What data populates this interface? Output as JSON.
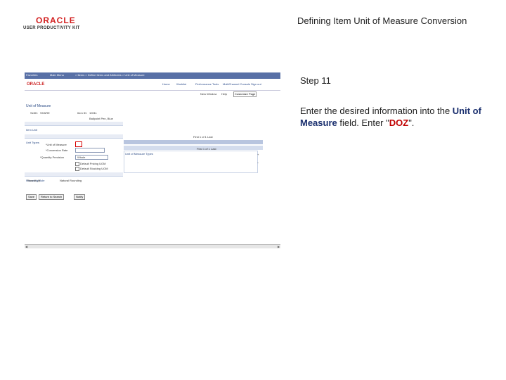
{
  "logo": {
    "brand": "ORACLE",
    "product": "USER PRODUCTIVITY KIT"
  },
  "slide_title": "Defining Item Unit of Measure Conversion",
  "step": "Step 11",
  "instruction": {
    "prefix": "Enter the desired information into the ",
    "field_name": "Unit of Measure",
    "middle": " field. Enter \"",
    "value": "DOZ",
    "suffix": "\"."
  },
  "screenshot": {
    "nav_items": [
      "Favorites",
      "Main Menu",
      "> Items > Define Items and Attributes > Unit of Measure"
    ],
    "brand": "ORACLE",
    "header_links": [
      "Home",
      "Worklist",
      "Performance Tools",
      "MultiChannel Console",
      "Add to Favorites",
      "Sign out"
    ],
    "toolbar": [
      "New Window",
      "Help",
      "Customize Page"
    ],
    "page_title": "Unit of Measure",
    "fields": [
      {
        "label": "SetID:",
        "value": "SHARE"
      },
      {
        "label": "Item ID:",
        "value": "10011"
      }
    ],
    "description": "Ballpoint Pen, Blue",
    "sections": [
      "Item Unit",
      "Unit Types",
      "Unit of Measure Types",
      "Rounding Rule"
    ],
    "grid_nav": "First 1 of 1 Last",
    "field_labels": [
      "*Unit of Measure",
      "*Conversion Rate",
      "*Quantity Precision"
    ],
    "precision_value": "Whole",
    "checkboxes": [
      "Default Pricing UOM",
      "Default Stocking UOM"
    ],
    "rounding": [
      "Round Up",
      "Natural Rounding"
    ],
    "buttons": [
      "Save",
      "Return to Search",
      "Notify"
    ]
  }
}
